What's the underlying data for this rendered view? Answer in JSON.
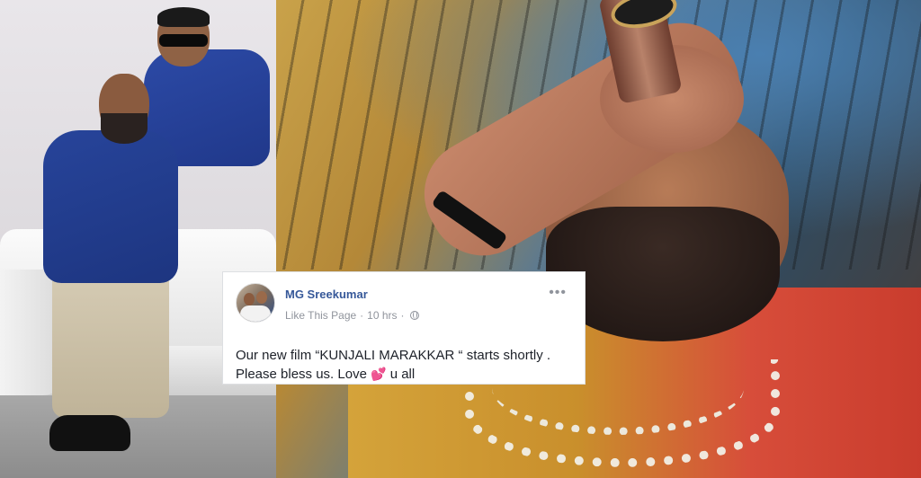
{
  "post": {
    "author": "MG Sreekumar",
    "like_link": "Like This Page",
    "separator": "·",
    "time": "10 hrs",
    "more_glyph": "•••",
    "text_line1": "Our new film “KUNJALI MARAKKAR “ starts shortly .",
    "text_line2_before": "Please bless us. Love ",
    "text_line2_after": " u all",
    "heart_glyph": "💕",
    "icons": {
      "privacy": "globe-icon",
      "menu": "more-icon",
      "emoji": "heart-icon"
    },
    "colors": {
      "author": "#365899",
      "meta": "#90949c",
      "text": "#1d2129"
    }
  }
}
